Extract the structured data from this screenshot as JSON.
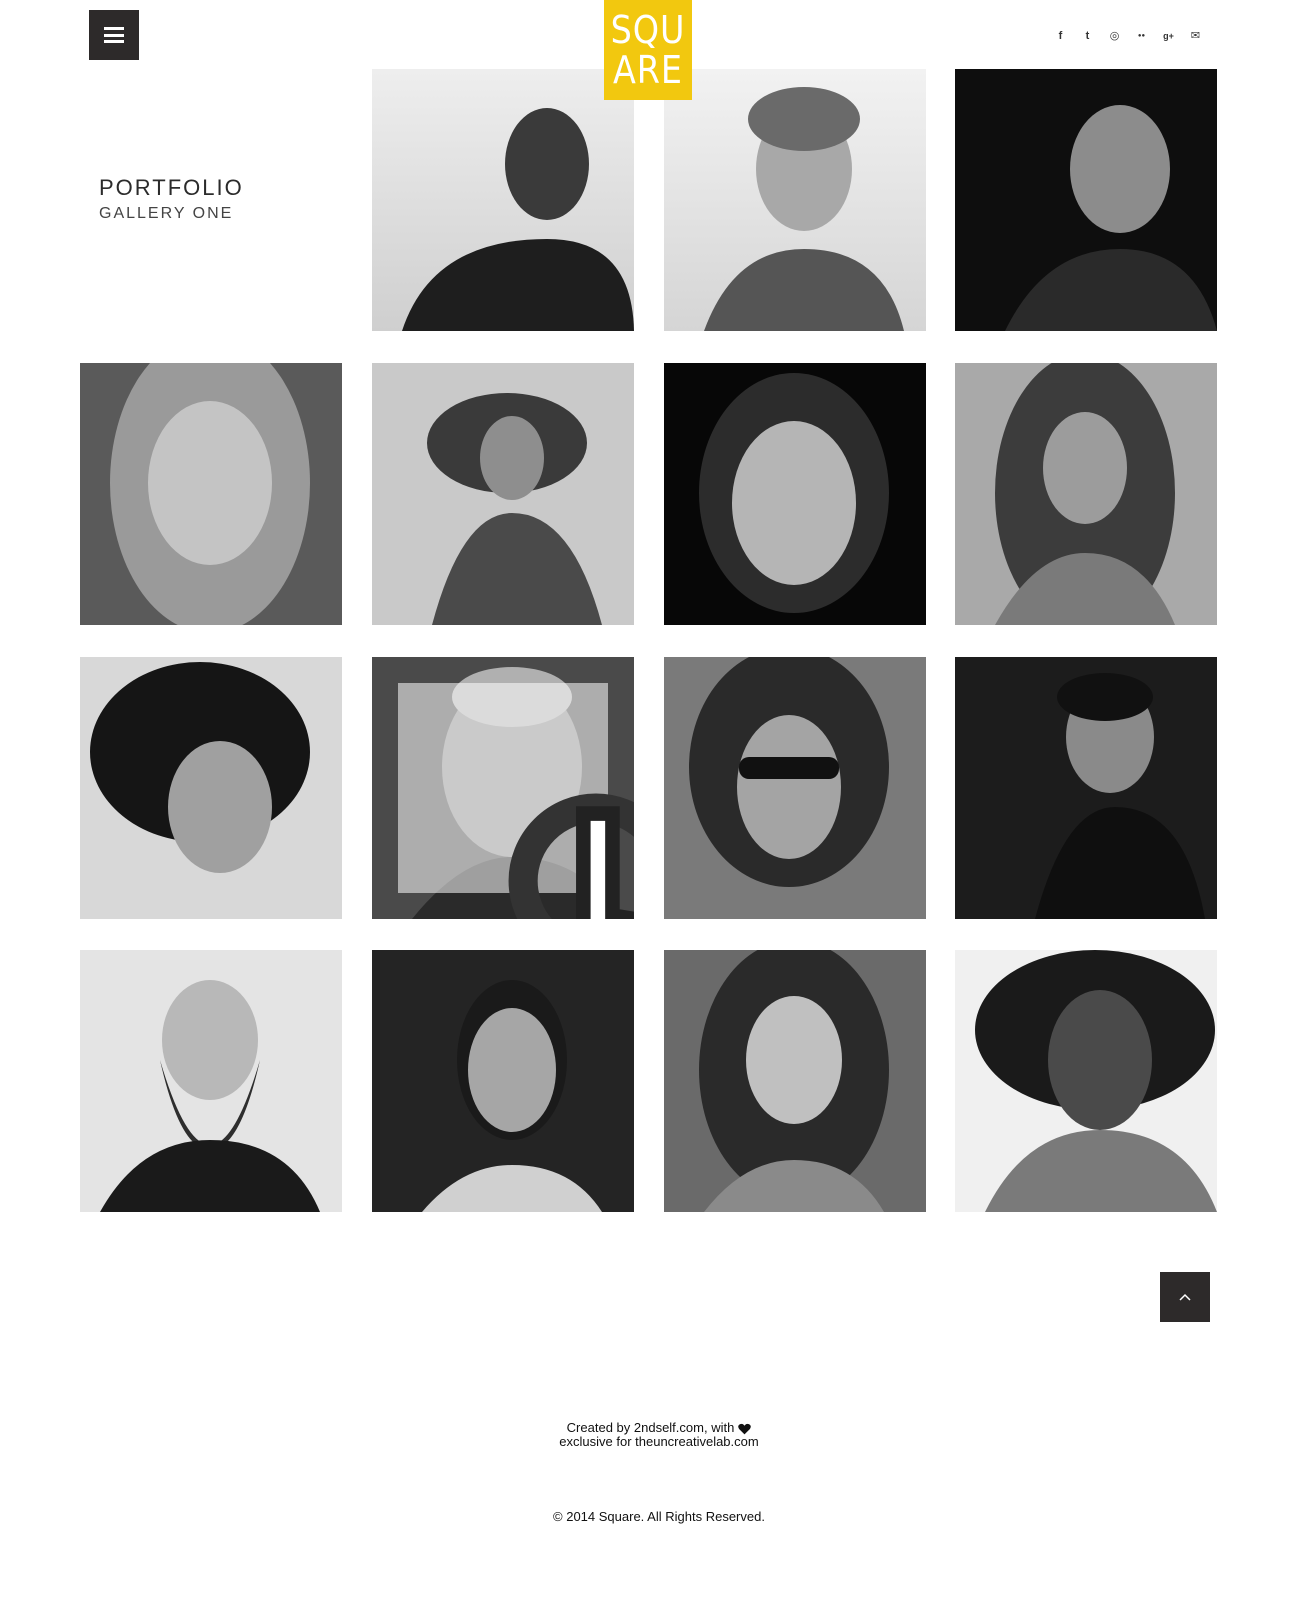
{
  "header": {
    "logo_line1": "SQU",
    "logo_line2": "ARE",
    "logo_color": "#f2c80f",
    "menu_icon": "hamburger-icon",
    "social": [
      {
        "name": "facebook-icon",
        "glyph": "f"
      },
      {
        "name": "twitter-icon",
        "glyph": "t"
      },
      {
        "name": "instagram-icon",
        "glyph": "◎"
      },
      {
        "name": "flickr-icon",
        "glyph": "●●"
      },
      {
        "name": "google-plus-icon",
        "glyph": "g+"
      },
      {
        "name": "email-icon",
        "glyph": "✉"
      }
    ]
  },
  "page": {
    "title": "PORTFOLIO",
    "subtitle": "GALLERY ONE"
  },
  "gallery": {
    "hover_icon": "search-icon",
    "items": [
      {
        "name": "portrait-1",
        "tone": "light"
      },
      {
        "name": "portrait-2",
        "tone": "light"
      },
      {
        "name": "portrait-3",
        "tone": "dark"
      },
      {
        "name": "portrait-4",
        "tone": "mid"
      },
      {
        "name": "portrait-5",
        "tone": "light"
      },
      {
        "name": "portrait-6",
        "tone": "dark"
      },
      {
        "name": "portrait-7",
        "tone": "mid"
      },
      {
        "name": "portrait-8",
        "tone": "mid"
      },
      {
        "name": "portrait-9",
        "tone": "mid",
        "hovered": true
      },
      {
        "name": "portrait-10",
        "tone": "mid"
      },
      {
        "name": "portrait-11",
        "tone": "dark"
      },
      {
        "name": "portrait-12",
        "tone": "light"
      },
      {
        "name": "portrait-13",
        "tone": "dark"
      },
      {
        "name": "portrait-14",
        "tone": "mid"
      },
      {
        "name": "portrait-15",
        "tone": "light"
      }
    ]
  },
  "back_to_top_icon": "chevron-up-icon",
  "footer": {
    "credit_line1": "Created by 2ndself.com, with",
    "credit_line2": "exclusive for theuncreativelab.com",
    "copyright": "© 2014 Square. All Rights Reserved."
  }
}
